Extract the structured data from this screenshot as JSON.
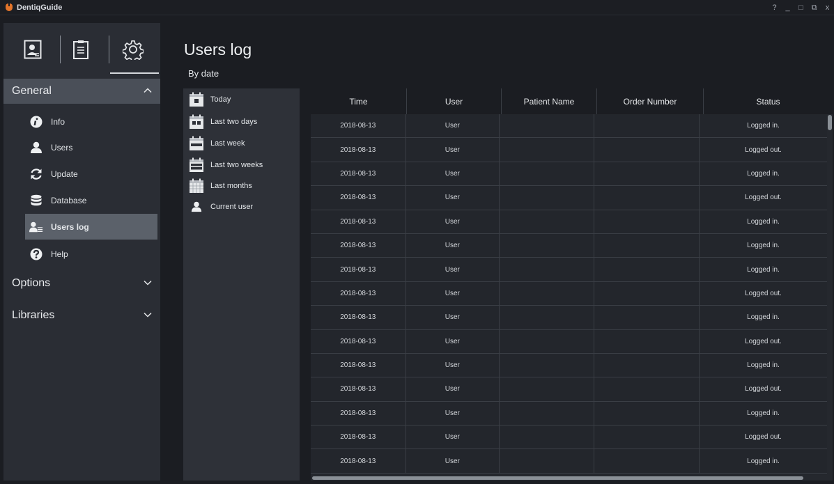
{
  "app": {
    "title": "DentiqGuide"
  },
  "window_controls": [
    "?",
    "_",
    "□",
    "⧉",
    "x"
  ],
  "sidebar": {
    "tabs": [
      {
        "icon": "patient-card-icon"
      },
      {
        "icon": "clipboard-icon"
      },
      {
        "icon": "gear-icon"
      }
    ],
    "groups": [
      {
        "label": "General",
        "expanded": true
      },
      {
        "label": "Options",
        "expanded": false
      },
      {
        "label": "Libraries",
        "expanded": false
      }
    ],
    "items": [
      {
        "label": "Info",
        "icon": "info-icon"
      },
      {
        "label": "Users",
        "icon": "user-icon"
      },
      {
        "label": "Update",
        "icon": "refresh-icon"
      },
      {
        "label": "Database",
        "icon": "database-icon"
      },
      {
        "label": "Users log",
        "icon": "users-log-icon",
        "active": true
      },
      {
        "label": "Help",
        "icon": "help-icon"
      }
    ]
  },
  "page": {
    "title": "Users log",
    "subtitle": "By date"
  },
  "filters": [
    {
      "label": "Today",
      "icon": "calendar-day-icon"
    },
    {
      "label": "Last two days",
      "icon": "calendar-two-days-icon"
    },
    {
      "label": "Last week",
      "icon": "calendar-week-icon"
    },
    {
      "label": "Last two weeks",
      "icon": "calendar-two-weeks-icon"
    },
    {
      "label": "Last months",
      "icon": "calendar-month-icon"
    },
    {
      "label": "Current user",
      "icon": "user-icon"
    }
  ],
  "table": {
    "columns": [
      "Time",
      "User",
      "Patient Name",
      "Order Number",
      "Status"
    ],
    "rows": [
      [
        "2018-08-13",
        "User",
        "",
        "",
        "Logged in."
      ],
      [
        "2018-08-13",
        "User",
        "",
        "",
        "Logged out."
      ],
      [
        "2018-08-13",
        "User",
        "",
        "",
        "Logged in."
      ],
      [
        "2018-08-13",
        "User",
        "",
        "",
        "Logged out."
      ],
      [
        "2018-08-13",
        "User",
        "",
        "",
        "Logged in."
      ],
      [
        "2018-08-13",
        "User",
        "",
        "",
        "Logged in."
      ],
      [
        "2018-08-13",
        "User",
        "",
        "",
        "Logged in."
      ],
      [
        "2018-08-13",
        "User",
        "",
        "",
        "Logged out."
      ],
      [
        "2018-08-13",
        "User",
        "",
        "",
        "Logged in."
      ],
      [
        "2018-08-13",
        "User",
        "",
        "",
        "Logged out."
      ],
      [
        "2018-08-13",
        "User",
        "",
        "",
        "Logged in."
      ],
      [
        "2018-08-13",
        "User",
        "",
        "",
        "Logged out."
      ],
      [
        "2018-08-13",
        "User",
        "",
        "",
        "Logged in."
      ],
      [
        "2018-08-13",
        "User",
        "",
        "",
        "Logged out."
      ],
      [
        "2018-08-13",
        "User",
        "",
        "",
        "Logged in."
      ]
    ]
  },
  "colors": {
    "background": "#1b1d22",
    "sidebar": "#2a2d34",
    "active_item": "#5b616a",
    "group_header": "#4a4f58",
    "accent_logo": "#e4752a"
  }
}
